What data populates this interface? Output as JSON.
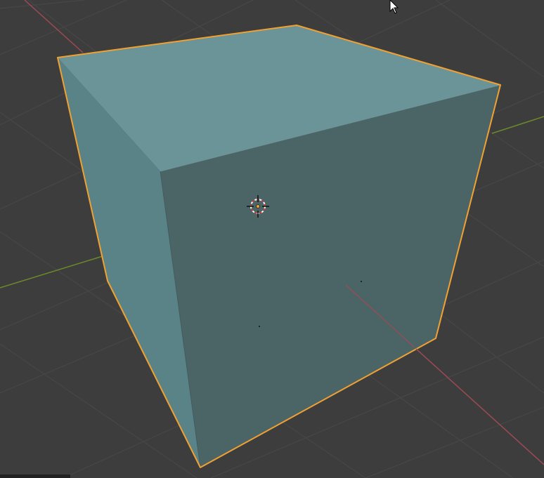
{
  "viewport": {
    "background_color": "#3d3d3d",
    "grid_line_color": "#474747",
    "x_axis_color": "#9e4a56",
    "y_axis_color": "#6b8a2a"
  },
  "object": {
    "name": "cube",
    "selected": true,
    "outline_color": "#f0a132",
    "face_colors": {
      "top": "#6b9498",
      "left": "#5a8387",
      "front": "#4b6567"
    }
  },
  "cursor": {
    "icon": "mouse-pointer-icon"
  },
  "origin_marker": {
    "icon": "object-origin-icon",
    "color": "#f0a132"
  },
  "cursor_3d": {
    "icon": "3d-cursor-icon"
  }
}
